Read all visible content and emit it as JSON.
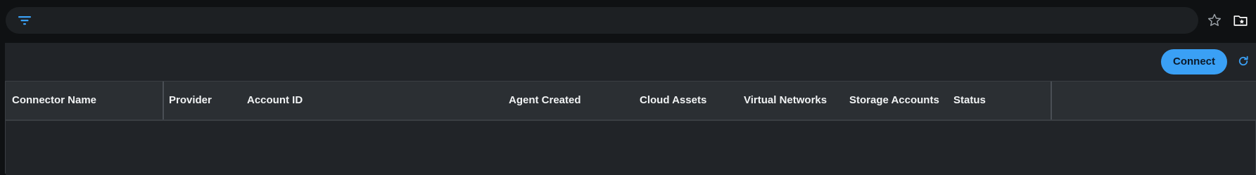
{
  "toolbar": {
    "filter_icon": "filter-icon",
    "favorite_icon": "star-outline-icon",
    "folder_icon": "folder-star-icon"
  },
  "actions": {
    "connect_label": "Connect",
    "refresh_icon": "refresh-icon"
  },
  "table": {
    "columns": [
      "Connector Name",
      "Provider",
      "Account ID",
      "Agent Created",
      "Cloud Assets",
      "Virtual Networks",
      "Storage Accounts",
      "Status"
    ],
    "rows": []
  },
  "colors": {
    "accent": "#3aa0f5",
    "background": "#0f1113",
    "panel": "#212428",
    "header": "#2b2f33"
  }
}
